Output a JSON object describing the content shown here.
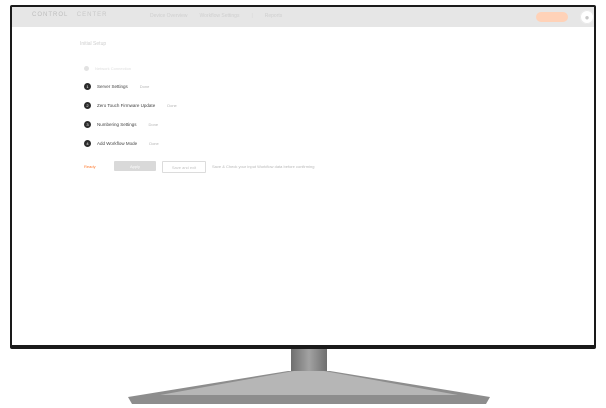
{
  "topbar": {
    "brand": "CONTROL",
    "brand_sub": "CENTER",
    "nav": [
      "Device Overview",
      "Workflow Settings",
      "Reports"
    ],
    "avatar_icon": "user-icon"
  },
  "page": {
    "title": "Initial Setup",
    "faded_step_label": "Network Connection"
  },
  "steps": [
    {
      "number": "1",
      "label": "Server Settings",
      "status": "Done"
    },
    {
      "number": "2",
      "label": "Zero Touch Firmware Update",
      "status": "Done"
    },
    {
      "number": "3",
      "label": "Numbering Settings",
      "status": "Done"
    },
    {
      "number": "4",
      "label": "Add Workflow Mode",
      "status": "Done"
    }
  ],
  "actions": {
    "status_text": "Ready",
    "primary_label": "Apply",
    "secondary_label": "Save and exit",
    "hint": "Save & Check your input Workflow data before confirming"
  },
  "colors": {
    "accent": "#ff7a2e",
    "step_dot": "#2b2b2b",
    "topbar": "#e6e6e6"
  }
}
